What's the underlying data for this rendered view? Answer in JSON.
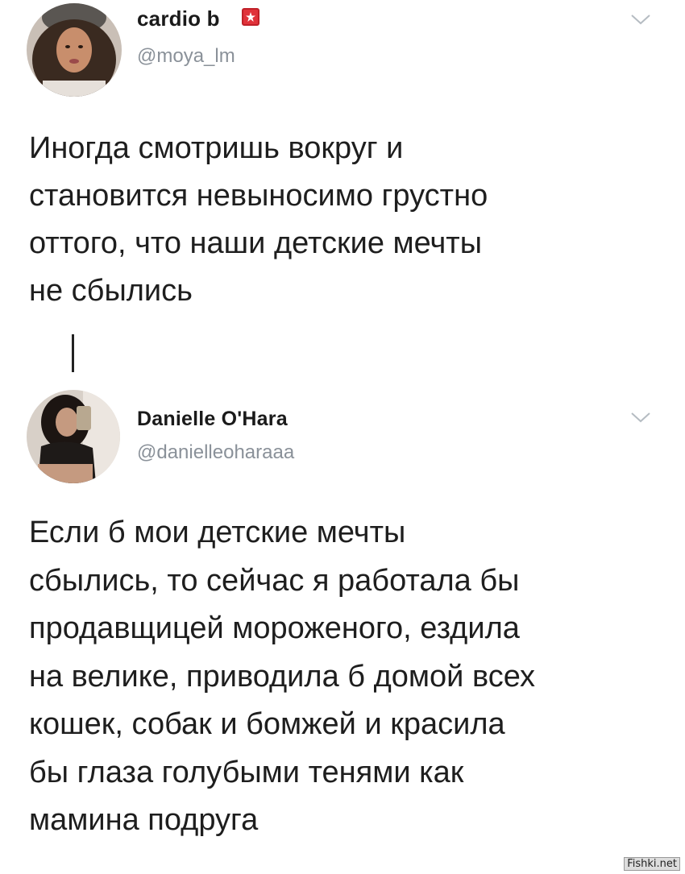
{
  "tweets": [
    {
      "display_name": "cardio b",
      "handle": "@moya_lm",
      "text": "Иногда смотришь вокруг и\nстановится невыносимо грустно\nоттого, что наши детские мечты\nне сбылись",
      "icons": {
        "avatar": "user-avatar",
        "badge": "emoji-badge-icon",
        "menu": "chevron-down-icon"
      }
    },
    {
      "display_name": "Danielle O'Hara",
      "handle": "@danielleoharaaa",
      "text": "Если б мои детские мечты\nсбылись, то сейчас я работала бы\nпродавщицей мороженого, ездила\nна велике, приводила б домой всех\nкошек, собак и бомжей и красила\nбы глаза голубыми тенями как\nмамина подруга",
      "icons": {
        "avatar": "user-avatar",
        "menu": "chevron-down-icon"
      }
    }
  ],
  "watermark": "Fishki.net",
  "colors": {
    "handle": "#8a9199",
    "text": "#1e1e1e",
    "background": "#ffffff"
  }
}
